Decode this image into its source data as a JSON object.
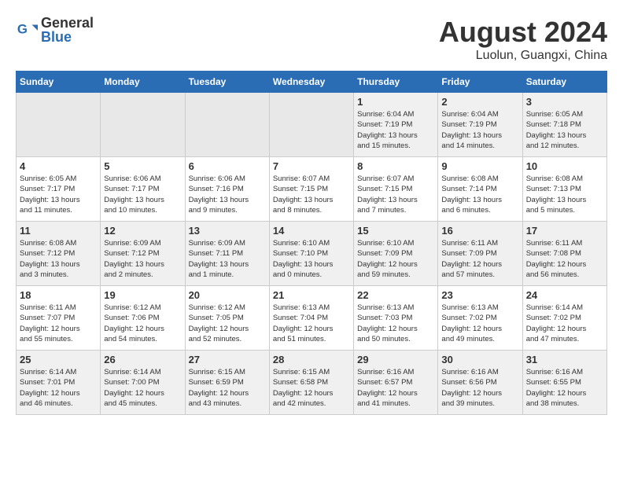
{
  "header": {
    "logo_general": "General",
    "logo_blue": "Blue",
    "month_title": "August 2024",
    "location": "Luolun, Guangxi, China"
  },
  "weekdays": [
    "Sunday",
    "Monday",
    "Tuesday",
    "Wednesday",
    "Thursday",
    "Friday",
    "Saturday"
  ],
  "weeks": [
    [
      {
        "day": "",
        "info": ""
      },
      {
        "day": "",
        "info": ""
      },
      {
        "day": "",
        "info": ""
      },
      {
        "day": "",
        "info": ""
      },
      {
        "day": "1",
        "info": "Sunrise: 6:04 AM\nSunset: 7:19 PM\nDaylight: 13 hours\nand 15 minutes."
      },
      {
        "day": "2",
        "info": "Sunrise: 6:04 AM\nSunset: 7:19 PM\nDaylight: 13 hours\nand 14 minutes."
      },
      {
        "day": "3",
        "info": "Sunrise: 6:05 AM\nSunset: 7:18 PM\nDaylight: 13 hours\nand 12 minutes."
      }
    ],
    [
      {
        "day": "4",
        "info": "Sunrise: 6:05 AM\nSunset: 7:17 PM\nDaylight: 13 hours\nand 11 minutes."
      },
      {
        "day": "5",
        "info": "Sunrise: 6:06 AM\nSunset: 7:17 PM\nDaylight: 13 hours\nand 10 minutes."
      },
      {
        "day": "6",
        "info": "Sunrise: 6:06 AM\nSunset: 7:16 PM\nDaylight: 13 hours\nand 9 minutes."
      },
      {
        "day": "7",
        "info": "Sunrise: 6:07 AM\nSunset: 7:15 PM\nDaylight: 13 hours\nand 8 minutes."
      },
      {
        "day": "8",
        "info": "Sunrise: 6:07 AM\nSunset: 7:15 PM\nDaylight: 13 hours\nand 7 minutes."
      },
      {
        "day": "9",
        "info": "Sunrise: 6:08 AM\nSunset: 7:14 PM\nDaylight: 13 hours\nand 6 minutes."
      },
      {
        "day": "10",
        "info": "Sunrise: 6:08 AM\nSunset: 7:13 PM\nDaylight: 13 hours\nand 5 minutes."
      }
    ],
    [
      {
        "day": "11",
        "info": "Sunrise: 6:08 AM\nSunset: 7:12 PM\nDaylight: 13 hours\nand 3 minutes."
      },
      {
        "day": "12",
        "info": "Sunrise: 6:09 AM\nSunset: 7:12 PM\nDaylight: 13 hours\nand 2 minutes."
      },
      {
        "day": "13",
        "info": "Sunrise: 6:09 AM\nSunset: 7:11 PM\nDaylight: 13 hours\nand 1 minute."
      },
      {
        "day": "14",
        "info": "Sunrise: 6:10 AM\nSunset: 7:10 PM\nDaylight: 13 hours\nand 0 minutes."
      },
      {
        "day": "15",
        "info": "Sunrise: 6:10 AM\nSunset: 7:09 PM\nDaylight: 12 hours\nand 59 minutes."
      },
      {
        "day": "16",
        "info": "Sunrise: 6:11 AM\nSunset: 7:09 PM\nDaylight: 12 hours\nand 57 minutes."
      },
      {
        "day": "17",
        "info": "Sunrise: 6:11 AM\nSunset: 7:08 PM\nDaylight: 12 hours\nand 56 minutes."
      }
    ],
    [
      {
        "day": "18",
        "info": "Sunrise: 6:11 AM\nSunset: 7:07 PM\nDaylight: 12 hours\nand 55 minutes."
      },
      {
        "day": "19",
        "info": "Sunrise: 6:12 AM\nSunset: 7:06 PM\nDaylight: 12 hours\nand 54 minutes."
      },
      {
        "day": "20",
        "info": "Sunrise: 6:12 AM\nSunset: 7:05 PM\nDaylight: 12 hours\nand 52 minutes."
      },
      {
        "day": "21",
        "info": "Sunrise: 6:13 AM\nSunset: 7:04 PM\nDaylight: 12 hours\nand 51 minutes."
      },
      {
        "day": "22",
        "info": "Sunrise: 6:13 AM\nSunset: 7:03 PM\nDaylight: 12 hours\nand 50 minutes."
      },
      {
        "day": "23",
        "info": "Sunrise: 6:13 AM\nSunset: 7:02 PM\nDaylight: 12 hours\nand 49 minutes."
      },
      {
        "day": "24",
        "info": "Sunrise: 6:14 AM\nSunset: 7:02 PM\nDaylight: 12 hours\nand 47 minutes."
      }
    ],
    [
      {
        "day": "25",
        "info": "Sunrise: 6:14 AM\nSunset: 7:01 PM\nDaylight: 12 hours\nand 46 minutes."
      },
      {
        "day": "26",
        "info": "Sunrise: 6:14 AM\nSunset: 7:00 PM\nDaylight: 12 hours\nand 45 minutes."
      },
      {
        "day": "27",
        "info": "Sunrise: 6:15 AM\nSunset: 6:59 PM\nDaylight: 12 hours\nand 43 minutes."
      },
      {
        "day": "28",
        "info": "Sunrise: 6:15 AM\nSunset: 6:58 PM\nDaylight: 12 hours\nand 42 minutes."
      },
      {
        "day": "29",
        "info": "Sunrise: 6:16 AM\nSunset: 6:57 PM\nDaylight: 12 hours\nand 41 minutes."
      },
      {
        "day": "30",
        "info": "Sunrise: 6:16 AM\nSunset: 6:56 PM\nDaylight: 12 hours\nand 39 minutes."
      },
      {
        "day": "31",
        "info": "Sunrise: 6:16 AM\nSunset: 6:55 PM\nDaylight: 12 hours\nand 38 minutes."
      }
    ]
  ]
}
